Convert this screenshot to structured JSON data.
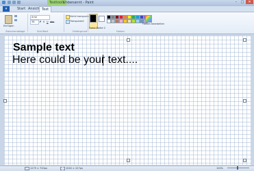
{
  "window": {
    "title": "Unbenannt - Paint",
    "tool_tab": "Texttools",
    "controls": {
      "minimize": "–",
      "maximize": "□",
      "close": "✕"
    }
  },
  "ribbon": {
    "file_label": "▾",
    "tabs": [
      {
        "label": "Start"
      },
      {
        "label": "Ansicht"
      },
      {
        "label": "Text"
      }
    ],
    "clipboard": {
      "paste_label": "Einfügen",
      "group_label": "Zwischenablage"
    },
    "font": {
      "family": "Arial",
      "size": "36",
      "bold": "F",
      "italic": "K",
      "underline": "U",
      "strike": "abc",
      "group_label": "Schriftart"
    },
    "background": {
      "opaque_label": "Nicht transparent",
      "transparent_label": "Transparent",
      "group_label": "Hintergrund"
    },
    "colors": {
      "color1_label": "Farbe 1",
      "color2_label": "Farbe 2",
      "edit_label": "Farben bearbeiten",
      "group_label": "Farben",
      "color1": "#000000",
      "color2": "#ffffff",
      "palette": [
        "#000000",
        "#7f7f7f",
        "#880015",
        "#ed1c24",
        "#ff7f27",
        "#fff200",
        "#22b14c",
        "#00a2e8",
        "#3f48cc",
        "#a349a4",
        "#ffffff",
        "#c3c3c3",
        "#b97a57",
        "#ffaec9",
        "#ffc90e",
        "#efe4b0",
        "#b5e61d",
        "#99d9ea",
        "#7092be",
        "#c8bfe7"
      ]
    }
  },
  "canvas": {
    "headline": "Sample text",
    "body": "Here could be your text...."
  },
  "statusbar": {
    "cursor_pos": "1279 × 720px",
    "selection_size": "1040 × 227px",
    "zoom": "100%"
  }
}
